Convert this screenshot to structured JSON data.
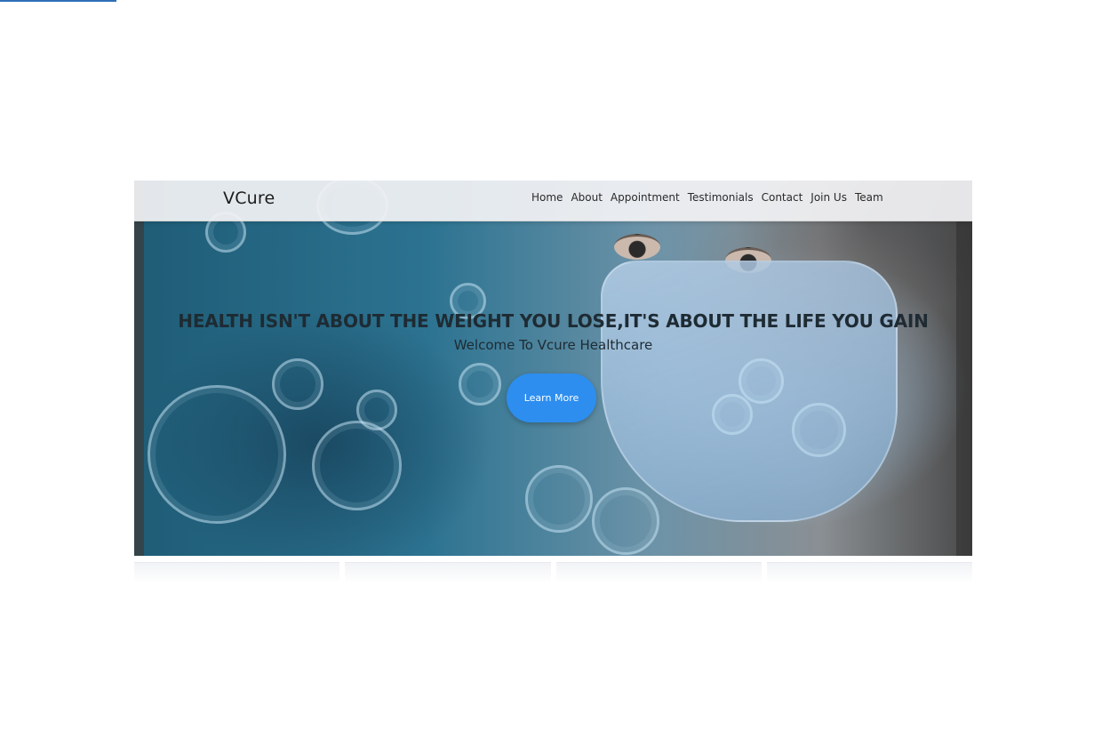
{
  "brand": {
    "name": "VCure"
  },
  "nav": {
    "links": [
      "Home",
      "About",
      "Appointment",
      "Testimonials",
      "Contact",
      "Join Us",
      "Team"
    ]
  },
  "hero": {
    "heading": "HEALTH ISN'T ABOUT THE WEIGHT YOU LOSE,IT'S ABOUT THE LIFE YOU GAIN",
    "subheading": "Welcome To Vcure Healthcare",
    "cta_label": "Learn More",
    "background_image": "woman-wearing-surgical-mask-with-virus-overlay"
  },
  "colors": {
    "accent": "#2d8ef0",
    "navbar_bg": "#f2f2f4",
    "top_accent": "#2f6fb7"
  }
}
